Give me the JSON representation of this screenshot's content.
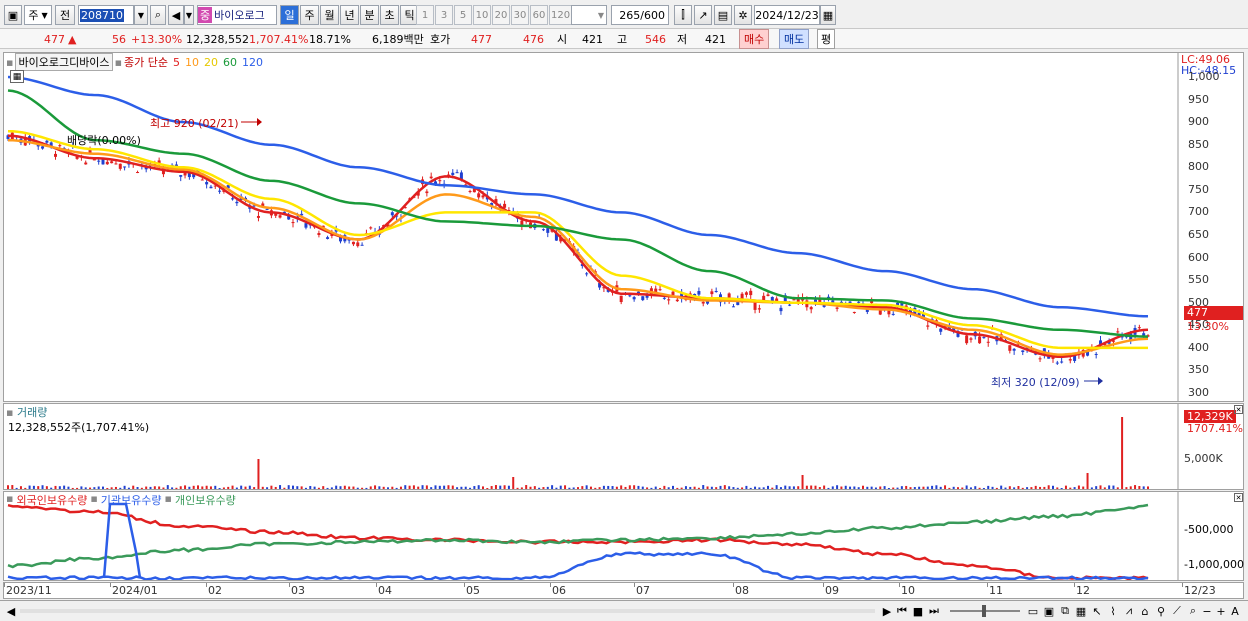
{
  "toolbar": {
    "period_type": "주",
    "prev_label": "전",
    "code": "208710",
    "stock_name": "바이오로그",
    "stock_badge": "중",
    "period_buttons": [
      "일",
      "주",
      "월",
      "년",
      "분",
      "초",
      "틱"
    ],
    "interval_buttons": [
      "1",
      "3",
      "5",
      "10",
      "20",
      "30",
      "60",
      "120"
    ],
    "count": "265",
    "count_max": "/600",
    "date": "2024/12/23"
  },
  "quote": {
    "price": "477",
    "change": "56",
    "change_pct": "+13.30%",
    "volume": "12,328,552",
    "volume_pct": "1,707.41%",
    "turnover": "18.71%",
    "amount": "6,189백만",
    "bid_label": "호가",
    "ask": "477",
    "bid": "476",
    "open_label": "시",
    "open": "421",
    "high_label": "고",
    "high": "546",
    "low_label": "저",
    "low": "421",
    "buy_label": "매수",
    "sell_label": "매도",
    "eval_label": "평"
  },
  "price_panel": {
    "name": "바이오로그디바이스",
    "ma_label": "종가 단순",
    "ma_periods": [
      "5",
      "10",
      "20",
      "60",
      "120"
    ],
    "lc": "LC:49.06",
    "hc": "HC:-48.15",
    "y_ticks": [
      "1,000",
      "950",
      "900",
      "850",
      "800",
      "750",
      "700",
      "650",
      "600",
      "550",
      "500",
      "450",
      "400",
      "350",
      "300"
    ],
    "current_price": "477",
    "current_pct": "13.30%",
    "high_note": "최고 920 (02/21)",
    "low_note": "최저 320 (12/09)",
    "dividend_note": "배당락(0.00%)"
  },
  "volume_panel": {
    "title": "거래량",
    "value": "12,328,552주(1,707.41%)",
    "current": "12,329K",
    "current_pct": "1707.41%",
    "y_tick": "5,000K"
  },
  "holding_panel": {
    "labels": [
      "외국인보유수량",
      "기관보유수량",
      "개인보유수량"
    ],
    "y_ticks": [
      "-500,000",
      "-1,000,000"
    ]
  },
  "x_axis": [
    "2023/11",
    "2024/01",
    "02",
    "03",
    "04",
    "05",
    "06",
    "07",
    "08",
    "09",
    "10",
    "11",
    "12",
    "12/23"
  ],
  "colors": {
    "ma5": "#e02020",
    "ma10": "#ff9a1a",
    "ma20": "#ffe600",
    "ma60": "#1a9a3a",
    "ma120": "#2c5ee8",
    "up": "#e02020",
    "down": "#2040d0",
    "foreign": "#e02020",
    "institution": "#2c5ee8",
    "individual": "#3a9a5a"
  },
  "chart_data": {
    "type": "line",
    "x": [
      "2023/11",
      "2024/01",
      "02",
      "03",
      "04",
      "05",
      "06",
      "07",
      "08",
      "09",
      "10",
      "11",
      "12",
      "12/23"
    ],
    "series": [
      {
        "name": "5",
        "values": [
          870,
          820,
          790,
          700,
          640,
          780,
          680,
          520,
          510,
          500,
          490,
          430,
          380,
          440
        ]
      },
      {
        "name": "10",
        "values": [
          860,
          830,
          795,
          710,
          640,
          740,
          690,
          530,
          505,
          500,
          485,
          440,
          385,
          420
        ]
      },
      {
        "name": "20",
        "values": [
          880,
          840,
          800,
          730,
          650,
          700,
          700,
          560,
          510,
          500,
          495,
          450,
          400,
          400
        ]
      },
      {
        "name": "60",
        "values": [
          970,
          860,
          830,
          770,
          720,
          680,
          670,
          640,
          570,
          510,
          505,
          465,
          440,
          425
        ]
      },
      {
        "name": "120",
        "values": [
          1000,
          960,
          900,
          850,
          800,
          760,
          740,
          700,
          650,
          610,
          570,
          530,
          490,
          470
        ]
      }
    ],
    "ylim": [
      300,
      1000
    ]
  }
}
